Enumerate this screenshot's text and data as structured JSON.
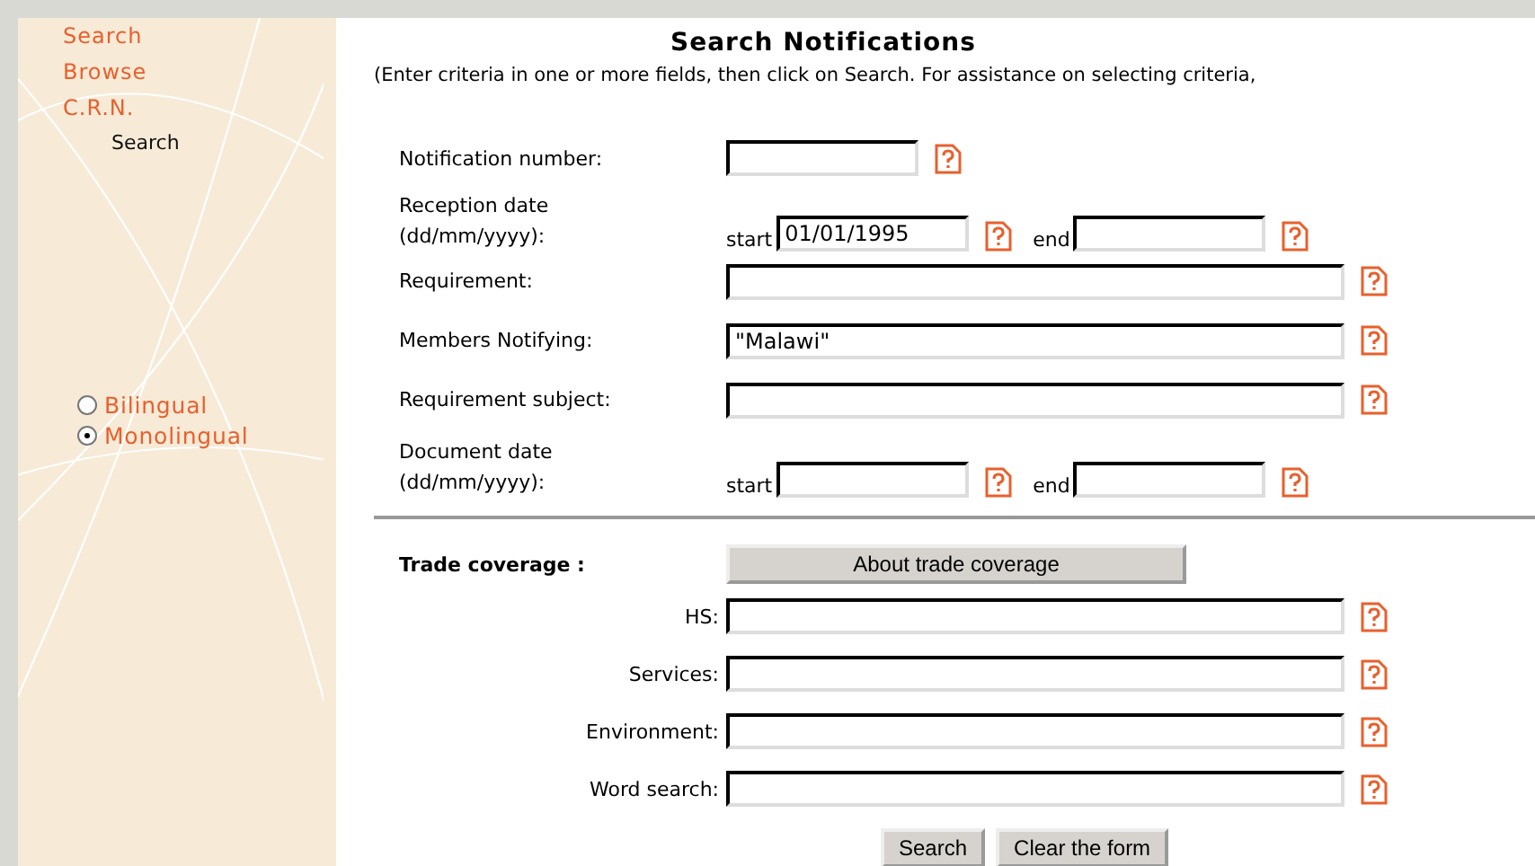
{
  "sidebar": {
    "links": [
      {
        "label": "Search"
      },
      {
        "label": "Browse"
      },
      {
        "label": "C.R.N."
      }
    ],
    "current": "Search",
    "languages": [
      {
        "label": "Bilingual",
        "selected": false
      },
      {
        "label": "Monolingual",
        "selected": true
      }
    ]
  },
  "title": "Search Notifications",
  "instructions": "(Enter criteria in one or more fields, then click on Search. For assistance on selecting criteria,",
  "fields": [
    {
      "kind": "short",
      "label": "Notification number:"
    },
    {
      "kind": "date",
      "label": "Reception date (dd/mm/yyyy):",
      "start_label": "start",
      "start": "01/01/1995",
      "end_label": "end"
    },
    {
      "kind": "long",
      "label": "Requirement:"
    },
    {
      "kind": "long",
      "label": "Members Notifying:",
      "value": "\"Malawi\""
    },
    {
      "kind": "long",
      "label": "Requirement subject:"
    },
    {
      "kind": "date",
      "label": "Document date (dd/mm/yyyy):",
      "start_label": "start",
      "end_label": "end"
    }
  ],
  "trade": {
    "label": "Trade coverage :",
    "button": "About trade coverage",
    "fields": [
      {
        "label": "HS:"
      },
      {
        "label": "Services:"
      },
      {
        "label": "Environment:"
      },
      {
        "label": "Word search:"
      }
    ]
  },
  "buttons": [
    "Search",
    "Clear the form"
  ]
}
